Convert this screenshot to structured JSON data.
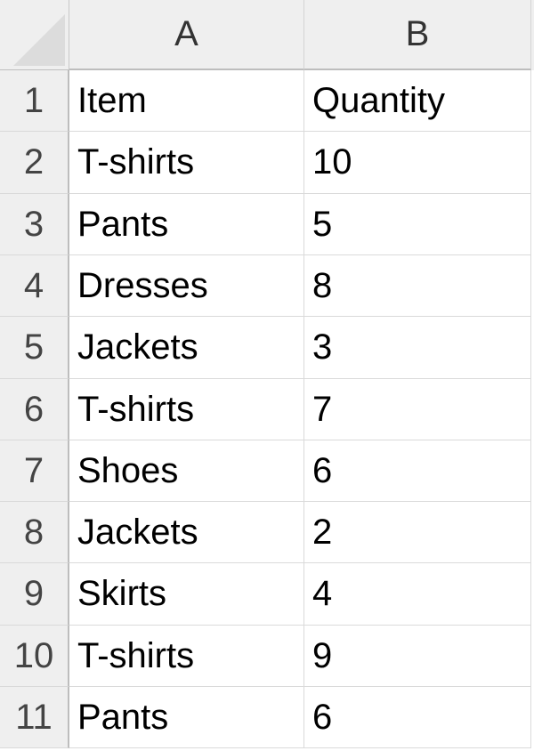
{
  "columns": [
    {
      "label": "A"
    },
    {
      "label": "B"
    }
  ],
  "rows": [
    {
      "num": "1",
      "a": "Item",
      "b": "Quantity"
    },
    {
      "num": "2",
      "a": "T-shirts",
      "b": "10"
    },
    {
      "num": "3",
      "a": "Pants",
      "b": "5"
    },
    {
      "num": "4",
      "a": "Dresses",
      "b": "8"
    },
    {
      "num": "5",
      "a": "Jackets",
      "b": "3"
    },
    {
      "num": "6",
      "a": "T-shirts",
      "b": "7"
    },
    {
      "num": "7",
      "a": "Shoes",
      "b": "6"
    },
    {
      "num": "8",
      "a": "Jackets",
      "b": "2"
    },
    {
      "num": "9",
      "a": "Skirts",
      "b": "4"
    },
    {
      "num": "10",
      "a": "T-shirts",
      "b": "9"
    },
    {
      "num": "11",
      "a": "Pants",
      "b": "6"
    }
  ]
}
